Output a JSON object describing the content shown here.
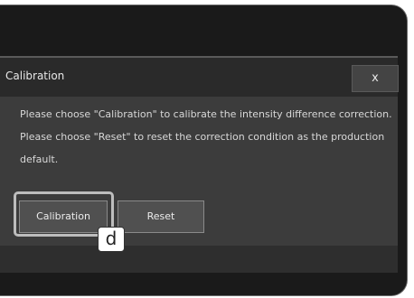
{
  "dialog": {
    "title": "Calibration",
    "close_label": "x",
    "message_lines": [
      "Please choose \"Calibration\" to calibrate the intensity difference correction.",
      "Please choose \"Reset\" to reset the correction condition as the production",
      "default."
    ],
    "buttons": {
      "calibration_label": "Calibration",
      "reset_label": "Reset"
    }
  },
  "callout": {
    "label": "d"
  }
}
